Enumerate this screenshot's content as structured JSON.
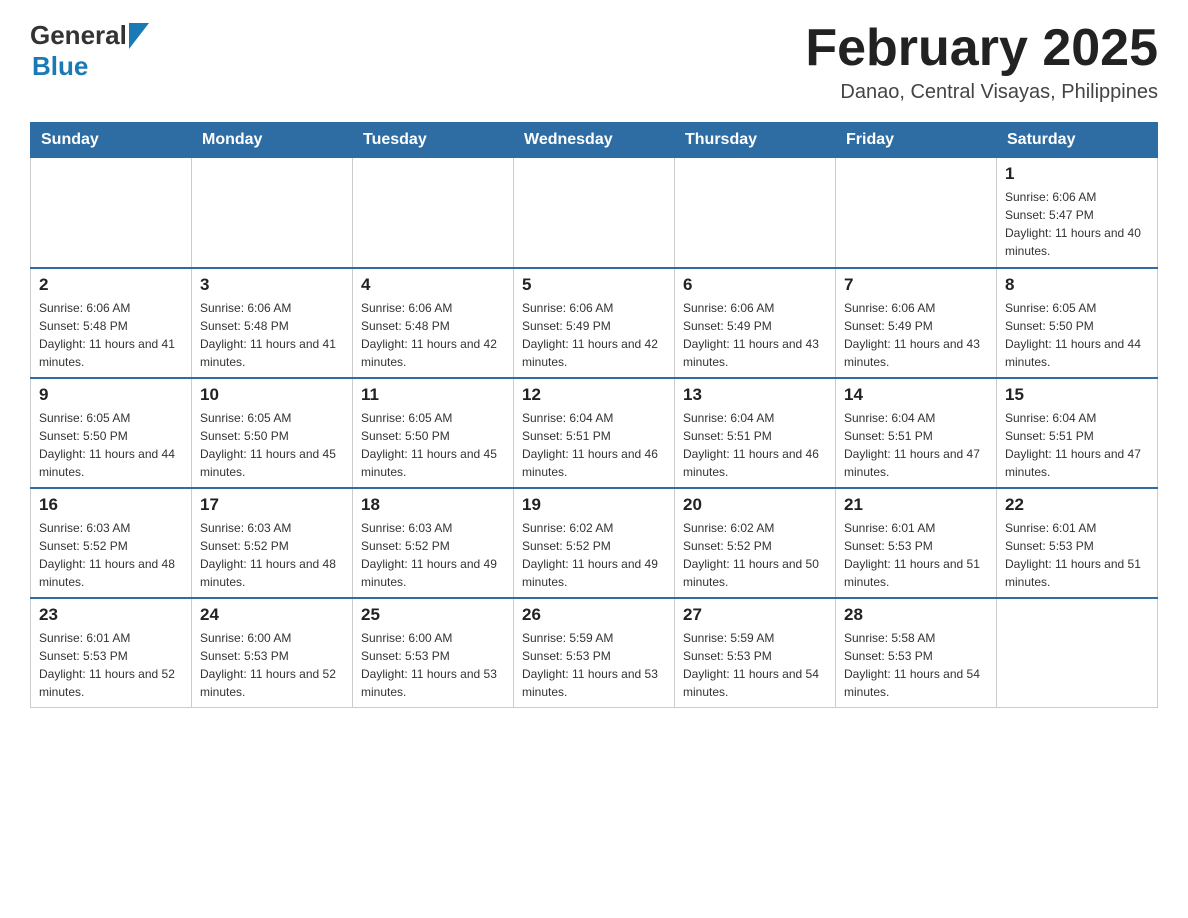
{
  "header": {
    "logo_general": "General",
    "logo_blue": "Blue",
    "title": "February 2025",
    "subtitle": "Danao, Central Visayas, Philippines"
  },
  "days_of_week": [
    "Sunday",
    "Monday",
    "Tuesday",
    "Wednesday",
    "Thursday",
    "Friday",
    "Saturday"
  ],
  "weeks": [
    {
      "days": [
        {
          "number": "",
          "sunrise": "",
          "sunset": "",
          "daylight": ""
        },
        {
          "number": "",
          "sunrise": "",
          "sunset": "",
          "daylight": ""
        },
        {
          "number": "",
          "sunrise": "",
          "sunset": "",
          "daylight": ""
        },
        {
          "number": "",
          "sunrise": "",
          "sunset": "",
          "daylight": ""
        },
        {
          "number": "",
          "sunrise": "",
          "sunset": "",
          "daylight": ""
        },
        {
          "number": "",
          "sunrise": "",
          "sunset": "",
          "daylight": ""
        },
        {
          "number": "1",
          "sunrise": "Sunrise: 6:06 AM",
          "sunset": "Sunset: 5:47 PM",
          "daylight": "Daylight: 11 hours and 40 minutes."
        }
      ]
    },
    {
      "days": [
        {
          "number": "2",
          "sunrise": "Sunrise: 6:06 AM",
          "sunset": "Sunset: 5:48 PM",
          "daylight": "Daylight: 11 hours and 41 minutes."
        },
        {
          "number": "3",
          "sunrise": "Sunrise: 6:06 AM",
          "sunset": "Sunset: 5:48 PM",
          "daylight": "Daylight: 11 hours and 41 minutes."
        },
        {
          "number": "4",
          "sunrise": "Sunrise: 6:06 AM",
          "sunset": "Sunset: 5:48 PM",
          "daylight": "Daylight: 11 hours and 42 minutes."
        },
        {
          "number": "5",
          "sunrise": "Sunrise: 6:06 AM",
          "sunset": "Sunset: 5:49 PM",
          "daylight": "Daylight: 11 hours and 42 minutes."
        },
        {
          "number": "6",
          "sunrise": "Sunrise: 6:06 AM",
          "sunset": "Sunset: 5:49 PM",
          "daylight": "Daylight: 11 hours and 43 minutes."
        },
        {
          "number": "7",
          "sunrise": "Sunrise: 6:06 AM",
          "sunset": "Sunset: 5:49 PM",
          "daylight": "Daylight: 11 hours and 43 minutes."
        },
        {
          "number": "8",
          "sunrise": "Sunrise: 6:05 AM",
          "sunset": "Sunset: 5:50 PM",
          "daylight": "Daylight: 11 hours and 44 minutes."
        }
      ]
    },
    {
      "days": [
        {
          "number": "9",
          "sunrise": "Sunrise: 6:05 AM",
          "sunset": "Sunset: 5:50 PM",
          "daylight": "Daylight: 11 hours and 44 minutes."
        },
        {
          "number": "10",
          "sunrise": "Sunrise: 6:05 AM",
          "sunset": "Sunset: 5:50 PM",
          "daylight": "Daylight: 11 hours and 45 minutes."
        },
        {
          "number": "11",
          "sunrise": "Sunrise: 6:05 AM",
          "sunset": "Sunset: 5:50 PM",
          "daylight": "Daylight: 11 hours and 45 minutes."
        },
        {
          "number": "12",
          "sunrise": "Sunrise: 6:04 AM",
          "sunset": "Sunset: 5:51 PM",
          "daylight": "Daylight: 11 hours and 46 minutes."
        },
        {
          "number": "13",
          "sunrise": "Sunrise: 6:04 AM",
          "sunset": "Sunset: 5:51 PM",
          "daylight": "Daylight: 11 hours and 46 minutes."
        },
        {
          "number": "14",
          "sunrise": "Sunrise: 6:04 AM",
          "sunset": "Sunset: 5:51 PM",
          "daylight": "Daylight: 11 hours and 47 minutes."
        },
        {
          "number": "15",
          "sunrise": "Sunrise: 6:04 AM",
          "sunset": "Sunset: 5:51 PM",
          "daylight": "Daylight: 11 hours and 47 minutes."
        }
      ]
    },
    {
      "days": [
        {
          "number": "16",
          "sunrise": "Sunrise: 6:03 AM",
          "sunset": "Sunset: 5:52 PM",
          "daylight": "Daylight: 11 hours and 48 minutes."
        },
        {
          "number": "17",
          "sunrise": "Sunrise: 6:03 AM",
          "sunset": "Sunset: 5:52 PM",
          "daylight": "Daylight: 11 hours and 48 minutes."
        },
        {
          "number": "18",
          "sunrise": "Sunrise: 6:03 AM",
          "sunset": "Sunset: 5:52 PM",
          "daylight": "Daylight: 11 hours and 49 minutes."
        },
        {
          "number": "19",
          "sunrise": "Sunrise: 6:02 AM",
          "sunset": "Sunset: 5:52 PM",
          "daylight": "Daylight: 11 hours and 49 minutes."
        },
        {
          "number": "20",
          "sunrise": "Sunrise: 6:02 AM",
          "sunset": "Sunset: 5:52 PM",
          "daylight": "Daylight: 11 hours and 50 minutes."
        },
        {
          "number": "21",
          "sunrise": "Sunrise: 6:01 AM",
          "sunset": "Sunset: 5:53 PM",
          "daylight": "Daylight: 11 hours and 51 minutes."
        },
        {
          "number": "22",
          "sunrise": "Sunrise: 6:01 AM",
          "sunset": "Sunset: 5:53 PM",
          "daylight": "Daylight: 11 hours and 51 minutes."
        }
      ]
    },
    {
      "days": [
        {
          "number": "23",
          "sunrise": "Sunrise: 6:01 AM",
          "sunset": "Sunset: 5:53 PM",
          "daylight": "Daylight: 11 hours and 52 minutes."
        },
        {
          "number": "24",
          "sunrise": "Sunrise: 6:00 AM",
          "sunset": "Sunset: 5:53 PM",
          "daylight": "Daylight: 11 hours and 52 minutes."
        },
        {
          "number": "25",
          "sunrise": "Sunrise: 6:00 AM",
          "sunset": "Sunset: 5:53 PM",
          "daylight": "Daylight: 11 hours and 53 minutes."
        },
        {
          "number": "26",
          "sunrise": "Sunrise: 5:59 AM",
          "sunset": "Sunset: 5:53 PM",
          "daylight": "Daylight: 11 hours and 53 minutes."
        },
        {
          "number": "27",
          "sunrise": "Sunrise: 5:59 AM",
          "sunset": "Sunset: 5:53 PM",
          "daylight": "Daylight: 11 hours and 54 minutes."
        },
        {
          "number": "28",
          "sunrise": "Sunrise: 5:58 AM",
          "sunset": "Sunset: 5:53 PM",
          "daylight": "Daylight: 11 hours and 54 minutes."
        },
        {
          "number": "",
          "sunrise": "",
          "sunset": "",
          "daylight": ""
        }
      ]
    }
  ]
}
